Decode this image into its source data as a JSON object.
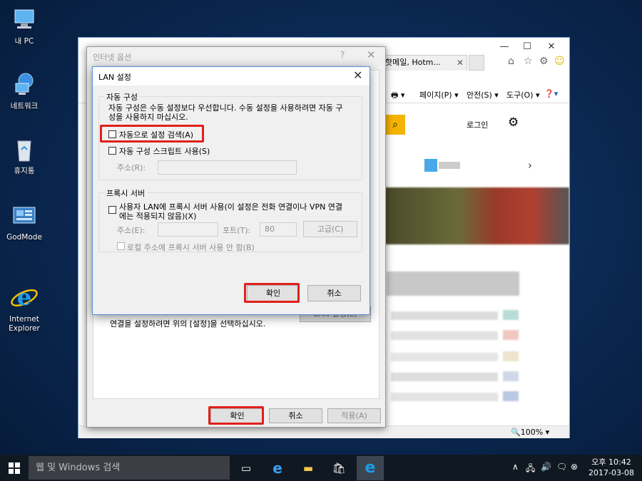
{
  "desktop": {
    "icons": [
      {
        "label": "내 PC",
        "icon": "computer-icon"
      },
      {
        "label": "네트워크",
        "icon": "network-icon"
      },
      {
        "label": "휴지통",
        "icon": "recycle-bin-icon"
      },
      {
        "label": "GodMode",
        "icon": "control-panel-icon"
      },
      {
        "label": "Internet\nExplorer",
        "icon": "internet-explorer-icon"
      }
    ]
  },
  "browser": {
    "tab_title": "핫메일, Hotm...",
    "command_bar": {
      "page": "페이지(P)",
      "safety": "안전(S)",
      "tools": "도구(O)"
    },
    "login_label": "로그인",
    "zoom": "100%"
  },
  "internet_options": {
    "title": "인터넷 옵션",
    "help": "?",
    "lan_text": "연결을 설정하려면 위의 [설정]을 선택하십시오.",
    "lan_button": "LAN 설정(L)",
    "ok": "확인",
    "cancel": "취소",
    "apply": "적용(A)"
  },
  "lan_dialog": {
    "title": "LAN 설정",
    "auto_group": {
      "legend": "자동 구성",
      "description_line1": "자동 구성은 수동 설정보다 우선합니다. 수동 설정을 사용하려면 자동 구",
      "description_line2": "성을 사용하지 마십시오.",
      "auto_detect": {
        "label": "자동으로 설정 검색(A)",
        "checked": false
      },
      "auto_script": {
        "label": "자동 구성 스크립트 사용(S)",
        "checked": false
      },
      "address_label": "주소(R):",
      "address_value": ""
    },
    "proxy_group": {
      "legend": "프록시 서버",
      "use_proxy_line1": "사용자 LAN에 프록시 서버 사용(이 설정은 전화 연결이나 VPN 연결",
      "use_proxy_line2": "에는 적용되지 않음)(X)",
      "use_proxy_checked": false,
      "address_label": "주소(E):",
      "address_value": "",
      "port_label": "포트(T):",
      "port_value": "80",
      "advanced": "고급(C)",
      "bypass_local": {
        "label": "로컬 주소에 프록시 서버 사용 안 함(B)",
        "checked": false
      }
    },
    "ok": "확인",
    "cancel": "취소"
  },
  "taskbar": {
    "search_placeholder": "웹 및 Windows 검색",
    "clock_time": "오후 10:42",
    "clock_date": "2017-03-08"
  },
  "colors": {
    "highlight": "#e0201c",
    "desktop": "#0b2a55",
    "search_button": "#f5b400"
  }
}
